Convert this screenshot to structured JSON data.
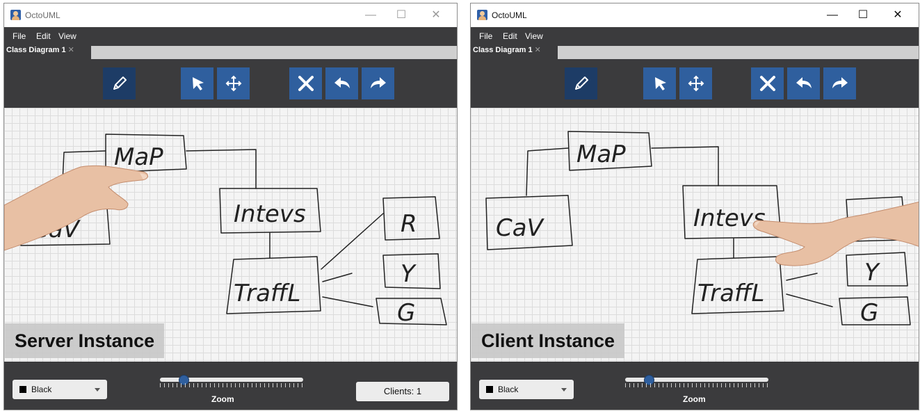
{
  "windows": {
    "left": {
      "title": "OctoUML",
      "menu": [
        "File",
        "Edit",
        "View"
      ],
      "tab": "Class Diagram 1",
      "caption": "Server Instance",
      "color_select": "Black",
      "zoom_label": "Zoom",
      "zoom_level": 0.16,
      "clients_label": "Clients: 1"
    },
    "right": {
      "title": "OctoUML",
      "menu": [
        "File",
        "Edit",
        "View"
      ],
      "tab": "Class Diagram 1",
      "caption": "Client Instance",
      "color_select": "Black",
      "zoom_label": "Zoom",
      "zoom_level": 0.16
    }
  },
  "window_controls": {
    "minimize": "—",
    "maximize": "☐",
    "close": "✕"
  },
  "tab_close": "✕",
  "toolbar_icons": [
    "pencil-icon",
    "select-arrow-icon",
    "move-icon",
    "delete-x-icon",
    "undo-icon",
    "redo-icon"
  ],
  "sketch_labels": [
    "MaP",
    "Intevs",
    "CaV",
    "R",
    "Y",
    "G",
    "TraffL"
  ],
  "colors": {
    "toolbar_bg": "#3b3b3d",
    "tool_blue": "#2f5f9e",
    "tool_active": "#1d3c66"
  }
}
